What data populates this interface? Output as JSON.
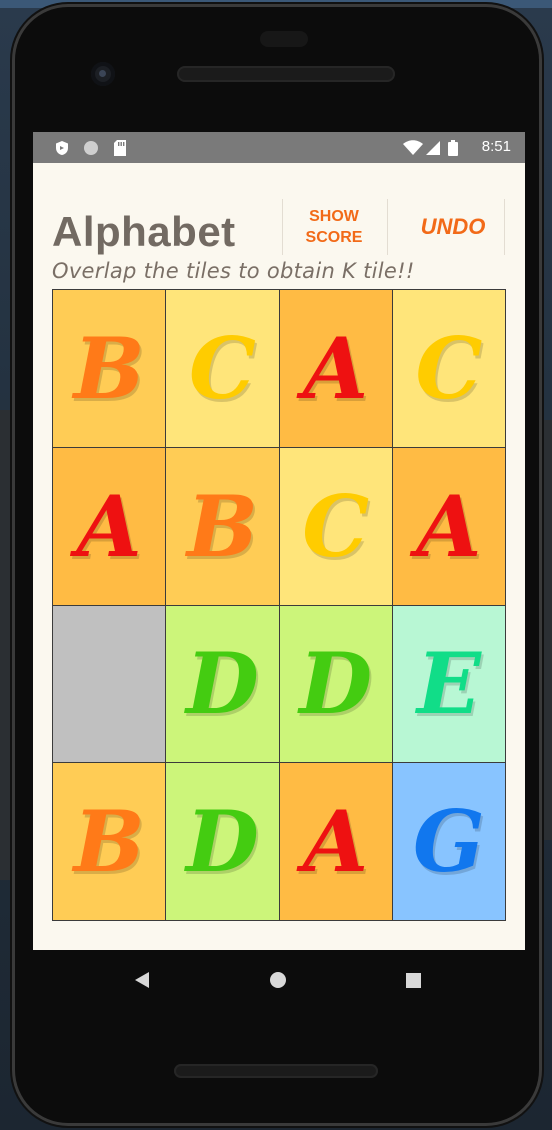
{
  "status_bar": {
    "time": "8:51",
    "left_icons": [
      "shield-icon",
      "circle-icon",
      "sd-card-icon"
    ],
    "right_icons": [
      "wifi-icon",
      "signal-icon",
      "battery-icon"
    ]
  },
  "header": {
    "title": "Alphabet",
    "subtitle": "Overlap the tiles to obtain K tile!!",
    "show_score_label": "SHOW\nSCORE",
    "undo_label": "UNDO"
  },
  "board": {
    "rows": 4,
    "cols": 4,
    "tiles": [
      {
        "letter": "B",
        "bg": "#ffcc55",
        "fg": "#ff7a18"
      },
      {
        "letter": "C",
        "bg": "#ffe57a",
        "fg": "#ffcc00"
      },
      {
        "letter": "A",
        "bg": "#ffbb44",
        "fg": "#ee1111"
      },
      {
        "letter": "C",
        "bg": "#ffe57a",
        "fg": "#ffcc00"
      },
      {
        "letter": "A",
        "bg": "#ffbb44",
        "fg": "#ee1111"
      },
      {
        "letter": "B",
        "bg": "#ffcc55",
        "fg": "#ff7a18"
      },
      {
        "letter": "C",
        "bg": "#ffe57a",
        "fg": "#ffcc00"
      },
      {
        "letter": "A",
        "bg": "#ffbb44",
        "fg": "#ee1111"
      },
      {
        "letter": "",
        "bg": "#c0c0c0",
        "fg": "#c0c0c0"
      },
      {
        "letter": "D",
        "bg": "#ccf57a",
        "fg": "#44cc11"
      },
      {
        "letter": "D",
        "bg": "#ccf57a",
        "fg": "#44cc11"
      },
      {
        "letter": "E",
        "bg": "#b8f7d4",
        "fg": "#11dd88"
      },
      {
        "letter": "B",
        "bg": "#ffcc55",
        "fg": "#ff7a18"
      },
      {
        "letter": "D",
        "bg": "#ccf57a",
        "fg": "#44cc11"
      },
      {
        "letter": "A",
        "bg": "#ffbb44",
        "fg": "#ee1111"
      },
      {
        "letter": "G",
        "bg": "#88c4ff",
        "fg": "#1177ee"
      }
    ]
  },
  "nav_bar": {
    "back_icon": "back-triangle-icon",
    "home_icon": "home-circle-icon",
    "recents_icon": "recents-square-icon"
  }
}
